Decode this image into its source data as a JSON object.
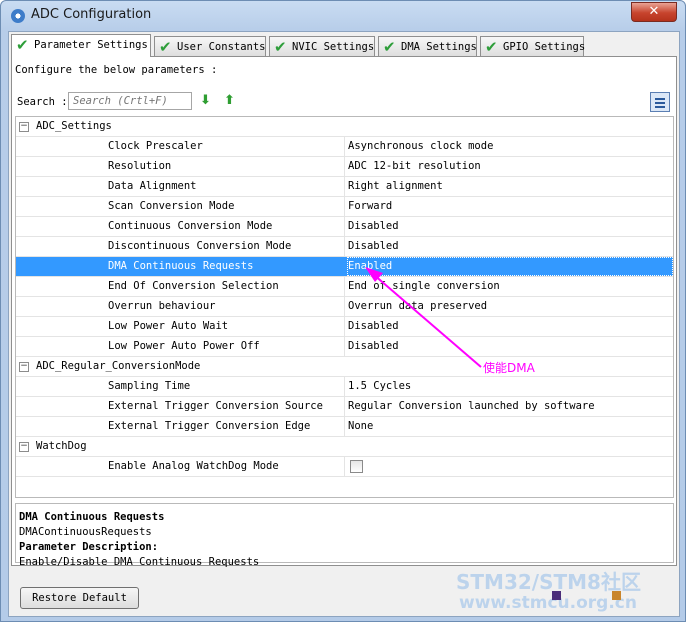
{
  "window": {
    "title": "ADC Configuration",
    "close_glyph": "✕"
  },
  "tabs": [
    {
      "label": "Parameter Settings",
      "active": true
    },
    {
      "label": "User Constants"
    },
    {
      "label": "NVIC Settings"
    },
    {
      "label": "DMA Settings"
    },
    {
      "label": "GPIO Settings"
    }
  ],
  "intro": "Configure the below parameters :",
  "search": {
    "label": "Search :",
    "placeholder": "Search (Crtl+F)"
  },
  "groups": [
    {
      "name": "ADC_Settings",
      "expander": "−",
      "params": [
        {
          "name": "Clock Prescaler",
          "value": "Asynchronous clock mode"
        },
        {
          "name": "Resolution",
          "value": "ADC 12-bit resolution"
        },
        {
          "name": "Data Alignment",
          "value": "Right alignment"
        },
        {
          "name": "Scan Conversion Mode",
          "value": "Forward"
        },
        {
          "name": "Continuous Conversion Mode",
          "value": "Disabled"
        },
        {
          "name": "Discontinuous Conversion Mode",
          "value": "Disabled"
        },
        {
          "name": "DMA Continuous Requests",
          "value": "Enabled"
        },
        {
          "name": "End Of Conversion Selection",
          "value": "End of single conversion"
        },
        {
          "name": "Overrun behaviour",
          "value": "Overrun data preserved"
        },
        {
          "name": "Low Power Auto Wait",
          "value": "Disabled"
        },
        {
          "name": "Low Power Auto Power Off",
          "value": "Disabled"
        }
      ]
    },
    {
      "name": "ADC_Regular_ConversionMode",
      "expander": "−",
      "params": [
        {
          "name": "Sampling Time",
          "value": "1.5 Cycles"
        },
        {
          "name": "External Trigger Conversion Source",
          "value": "Regular Conversion launched by software"
        },
        {
          "name": "External Trigger Conversion Edge",
          "value": "None"
        }
      ]
    },
    {
      "name": "WatchDog",
      "expander": "−",
      "params": [
        {
          "name": "Enable Analog WatchDog Mode",
          "value": "",
          "checkbox": true,
          "checked": false
        }
      ]
    }
  ],
  "description": {
    "title": "DMA Continuous Requests",
    "identifier": "DMAContinuousRequests",
    "heading": "Parameter Description:",
    "text": "Enable/Disable DMA Continuous Requests"
  },
  "buttons": {
    "restore": "Restore Default"
  },
  "annotation": {
    "text": "使能DMA",
    "color": "#ff00ff"
  },
  "watermark": {
    "line1": "STM32/STM8社区",
    "line2": "www.stmcu.org.cn"
  },
  "colors": {
    "selection": "#3399ff",
    "check": "#2e9e3a"
  }
}
